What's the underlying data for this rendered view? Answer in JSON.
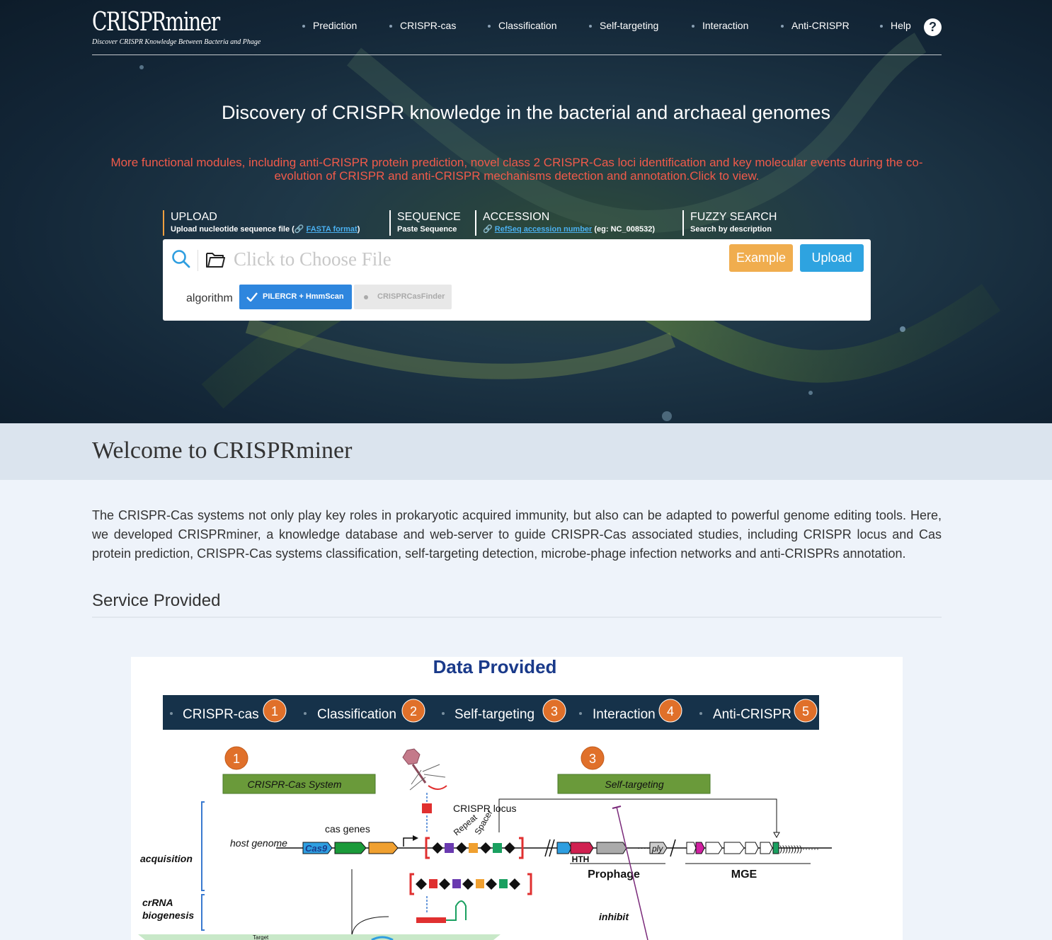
{
  "logo": {
    "title": "CRISPRminer",
    "subtitle": "Discover CRISPR Knowledge Between Bacteria and Phage"
  },
  "nav": {
    "items": [
      "Prediction",
      "CRISPR-cas",
      "Classification",
      "Self-targeting",
      "Interaction",
      "Anti-CRISPR",
      "Help"
    ],
    "help_icon": "?"
  },
  "hero": {
    "title": "Discovery of CRISPR knowledge in the bacterial and archaeal genomes",
    "notice": "More functional modules, including anti-CRISPR protein prediction, novel class 2 CRISPR-Cas loci identification and key molecular events during the co-evolution of CRISPR and anti-CRISPR mechanisms detection and annotation.Click to view."
  },
  "tabs": {
    "upload": {
      "title": "UPLOAD",
      "sub_prefix": "Upload nucleotide sequence file (",
      "link": "FASTA format",
      "sub_suffix": ")"
    },
    "sequence": {
      "title": "SEQUENCE",
      "sub": "Paste Sequence"
    },
    "accession": {
      "title": "ACCESSION",
      "link": "RefSeq accession number",
      "sub_suffix": " (eg: NC_008532)"
    },
    "fuzzy": {
      "title": "FUZZY SEARCH",
      "sub": "Search by description"
    }
  },
  "search": {
    "placeholder": "Click to Choose File",
    "example_label": "Example",
    "upload_label": "Upload",
    "algorithm_label": "algorithm",
    "algorithms": [
      "PILERCR + HmmScan",
      "CRISPRCasFinder"
    ]
  },
  "welcome": {
    "title": "Welcome to CRISPRminer",
    "intro": "The CRISPR-Cas systems not only play key roles in prokaryotic acquired immunity, but also can be adapted to powerful genome editing tools. Here, we developed CRISPRminer, a knowledge database and web-server to guide CRISPR-Cas associated studies, including CRISPR locus and Cas protein prediction, CRISPR-Cas systems classification, self-targeting detection, microbe-phage infection networks and anti-CRISPRs annotation.",
    "service_title": "Service Provided"
  },
  "diagram": {
    "title": "Data Provided",
    "bar_items": [
      {
        "label": "CRISPR-cas",
        "num": "1"
      },
      {
        "label": "Classification",
        "num": "2"
      },
      {
        "label": "Self-targeting",
        "num": "3"
      },
      {
        "label": "Interaction",
        "num": "4"
      },
      {
        "label": "Anti-CRISPR",
        "num": "5"
      }
    ],
    "panel1_num": "1",
    "panel1_label": "CRISPR-Cas System",
    "panel3_num": "3",
    "panel3_label": "Self-targeting",
    "crispr_locus": "CRISPR locus",
    "cas_genes": "cas genes",
    "host_genome": "host genome",
    "cas9": "Cas9",
    "repeat": "Repeat",
    "spacer": "Spacer",
    "hth": "HTH",
    "ply": "ply",
    "prophage": "Prophage",
    "mge": "MGE",
    "acquisition": "acquisition",
    "crrna": "crRNA",
    "biogenesis": "biogenesis",
    "inhibit": "inhibit",
    "target": "Target",
    "colors": {
      "orange": "#e0702a",
      "green": "#6a9a3a",
      "navy": "#1a3a8a",
      "red": "#e03030"
    }
  }
}
